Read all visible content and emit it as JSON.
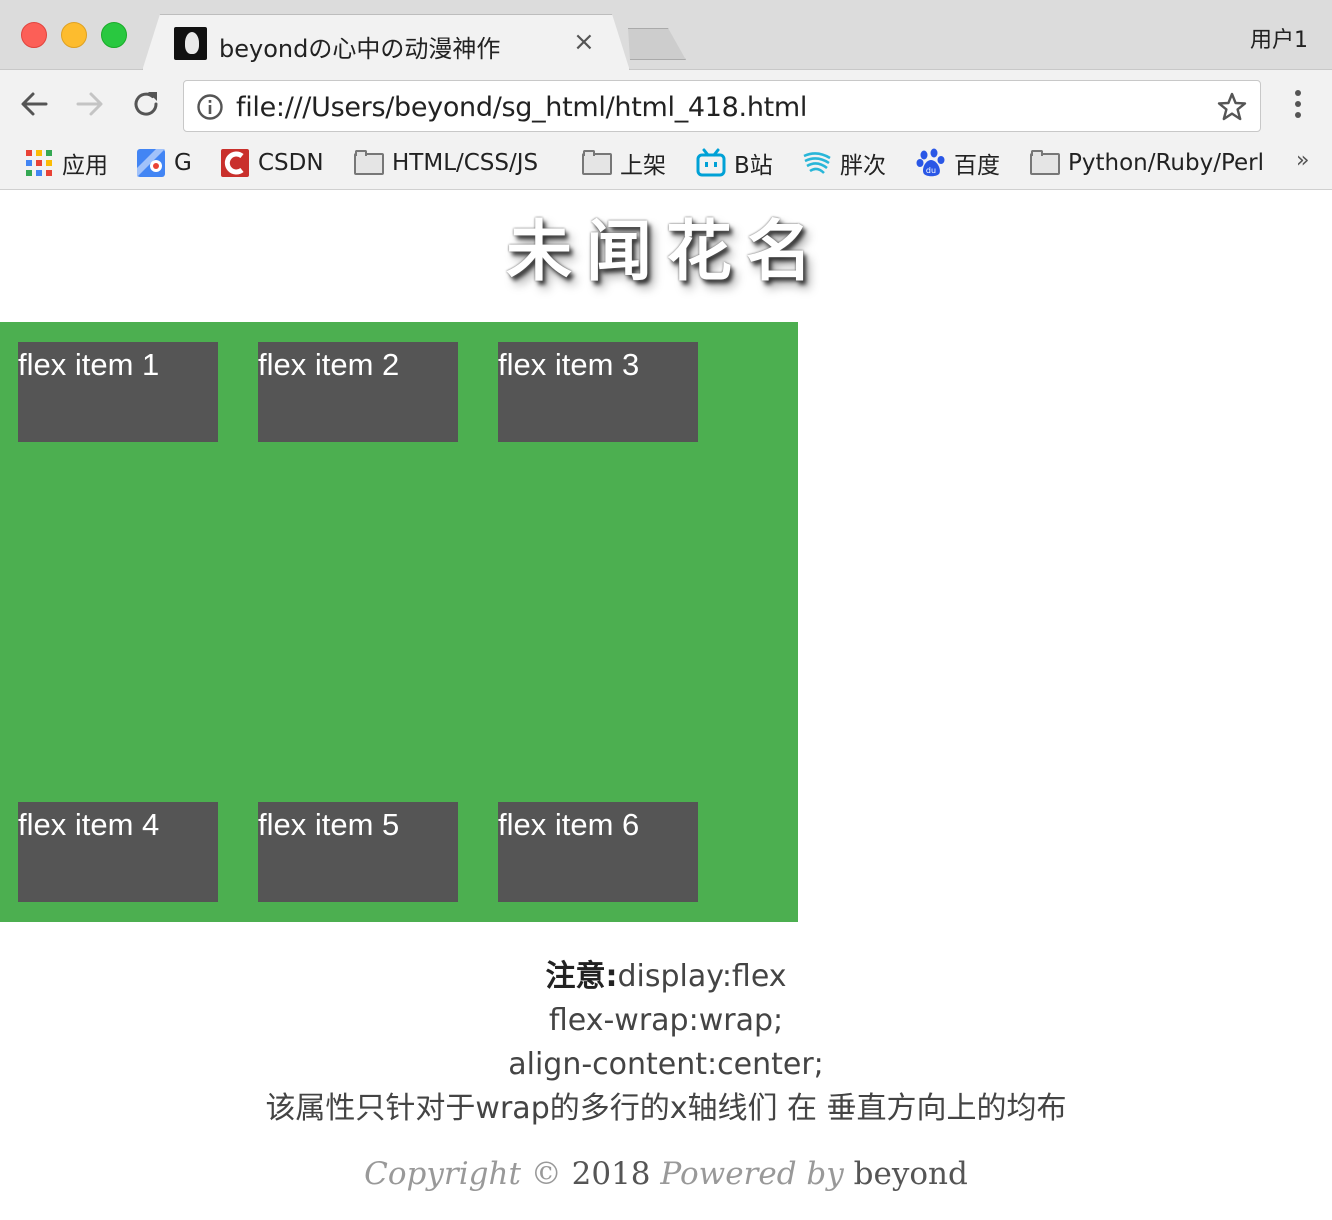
{
  "browser": {
    "tab_title": "beyondの心中の动漫神作",
    "tab_close": "×",
    "user_label": "用户1",
    "url": "file:///Users/beyond/sg_html/html_418.html",
    "overflow": "»",
    "bookmarks": [
      {
        "icon": "apps-grid-icon",
        "label": "应用"
      },
      {
        "icon": "google-maps-icon",
        "label": "G"
      },
      {
        "icon": "csdn-icon",
        "label": "CSDN"
      },
      {
        "icon": "folder-icon",
        "label": "HTML/CSS/JS"
      },
      {
        "icon": "folder-icon",
        "label": "上架"
      },
      {
        "icon": "bilibili-icon",
        "label": "B站"
      },
      {
        "icon": "wave-icon",
        "label": "胖次"
      },
      {
        "icon": "baidu-paw-icon",
        "label": "百度"
      },
      {
        "icon": "folder-icon",
        "label": "Python/Ruby/Perl"
      }
    ]
  },
  "page": {
    "heading": "未闻花名",
    "items": [
      "flex item 1",
      "flex item 2",
      "flex item 3",
      "flex item 4",
      "flex item 5",
      "flex item 6"
    ],
    "note": {
      "strong": "注意:",
      "line1_rest": "display:flex",
      "line2": "flex-wrap:wrap;",
      "line3": "align-content:center;",
      "line4": "该属性只针对于wrap的多行的x轴线们 在 垂直方向上的均布"
    },
    "footer": {
      "copyright": "Copyright",
      "symbol": "©",
      "year": "2018",
      "powered": "Powered by",
      "author": "beyond"
    }
  },
  "colors": {
    "container_bg": "#4caf50",
    "item_bg": "#555555"
  }
}
